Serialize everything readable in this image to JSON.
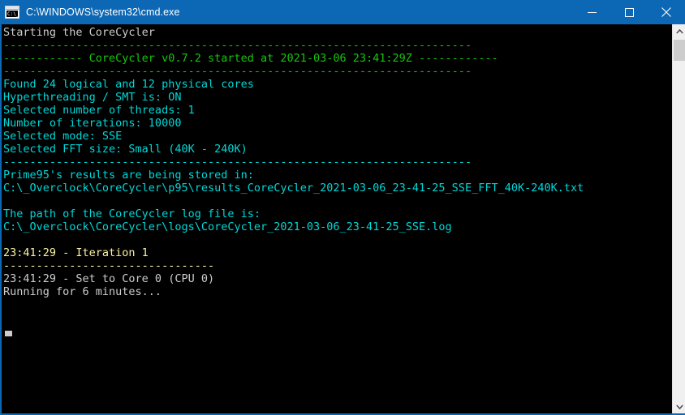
{
  "window": {
    "title": "C:\\WINDOWS\\system32\\cmd.exe",
    "icon_name": "cmd-exe-icon",
    "icon_glyph": "C:\\_",
    "titlebar_color": "#0c68b4",
    "background_color": "#000000",
    "controls": {
      "minimize_label": "Minimize",
      "maximize_label": "Maximize",
      "close_label": "Close"
    }
  },
  "colors": {
    "white": "#cccccc",
    "green": "#16c60c",
    "cyan": "#3a96dd",
    "bright_cyan": "#00d7d7",
    "yellow": "#f9f1a5"
  },
  "console": {
    "lines": [
      {
        "text": "Starting the CoreCycler",
        "color": "white"
      },
      {
        "text": "-----------------------------------------------------------------------",
        "color": "green"
      },
      {
        "text": "------------ CoreCycler v0.7.2 started at 2021-03-06 23:41:29Z ------------",
        "color": "green"
      },
      {
        "text": "-----------------------------------------------------------------------",
        "color": "green"
      },
      {
        "text": "Found 24 logical and 12 physical cores",
        "color": "bright_cyan"
      },
      {
        "text": "Hyperthreading / SMT is: ON",
        "color": "bright_cyan"
      },
      {
        "text": "Selected number of threads: 1",
        "color": "bright_cyan"
      },
      {
        "text": "Number of iterations: 10000",
        "color": "bright_cyan"
      },
      {
        "text": "Selected mode: SSE",
        "color": "bright_cyan"
      },
      {
        "text": "Selected FFT size: Small (40K - 240K)",
        "color": "bright_cyan"
      },
      {
        "text": "-----------------------------------------------------------------------",
        "color": "bright_cyan"
      },
      {
        "text": "Prime95's results are being stored in:",
        "color": "bright_cyan"
      },
      {
        "text": "C:\\_Overclock\\CoreCycler\\p95\\results_CoreCycler_2021-03-06_23-41-25_SSE_FFT_40K-240K.txt",
        "color": "bright_cyan"
      },
      {
        "text": "",
        "color": "white"
      },
      {
        "text": "The path of the CoreCycler log file is:",
        "color": "bright_cyan"
      },
      {
        "text": "C:\\_Overclock\\CoreCycler\\logs\\CoreCycler_2021-03-06_23-41-25_SSE.log",
        "color": "bright_cyan"
      },
      {
        "text": "",
        "color": "white"
      },
      {
        "text": "23:41:29 - Iteration 1",
        "color": "yellow"
      },
      {
        "text": "--------------------------------",
        "color": "yellow"
      },
      {
        "text": "23:41:29 - Set to Core 0 (CPU 0)",
        "color": "white"
      },
      {
        "text": "Running for 6 minutes...",
        "color": "white"
      }
    ],
    "cursor_visible": true
  },
  "scrollbar": {
    "up_arrow_name": "scroll-up-arrow",
    "down_arrow_name": "scroll-down-arrow",
    "thumb_name": "scrollbar-thumb"
  }
}
